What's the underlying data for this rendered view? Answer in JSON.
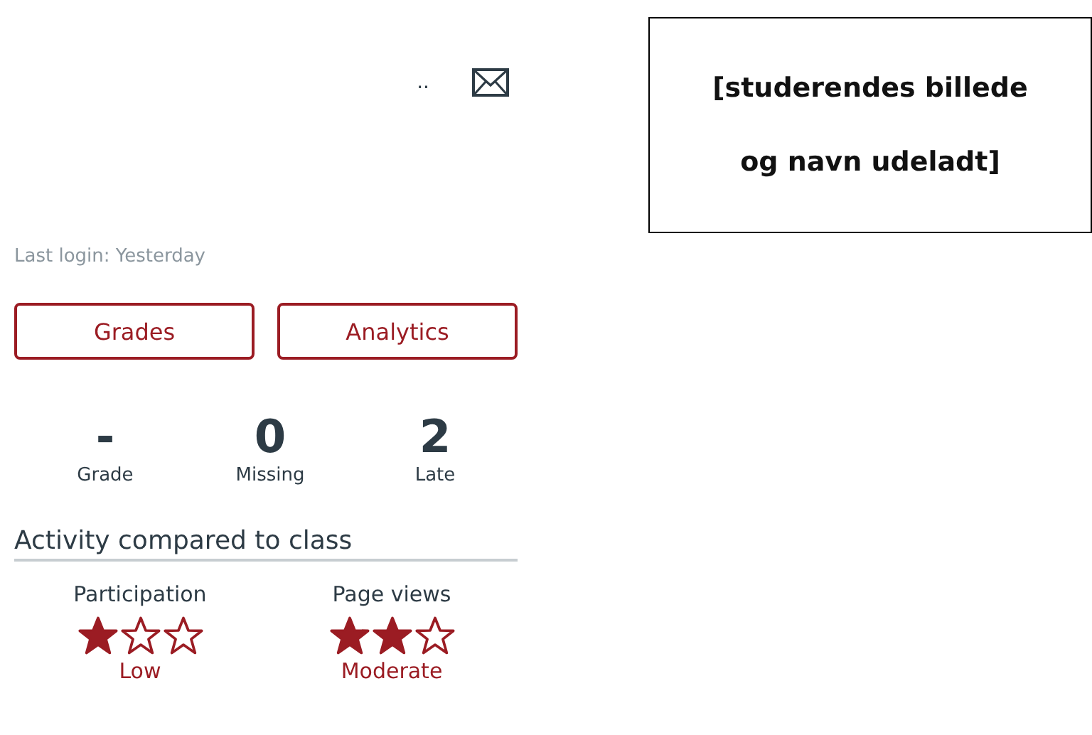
{
  "profile": {
    "more": "..",
    "last_login": "Last login: Yesterday"
  },
  "buttons": [
    {
      "label": "Grades"
    },
    {
      "label": "Analytics"
    }
  ],
  "stats": [
    {
      "value": "-",
      "label": "Grade"
    },
    {
      "value": "0",
      "label": "Missing"
    },
    {
      "value": "2",
      "label": "Late"
    }
  ],
  "activity": {
    "title": "Activity compared to class",
    "metrics": [
      {
        "name": "Participation",
        "stars": 1,
        "rating": "Low"
      },
      {
        "name": "Page views",
        "stars": 2,
        "rating": "Moderate"
      }
    ]
  },
  "note": {
    "lines": [
      "[studerendes billede",
      "og navn udeladt]"
    ]
  }
}
